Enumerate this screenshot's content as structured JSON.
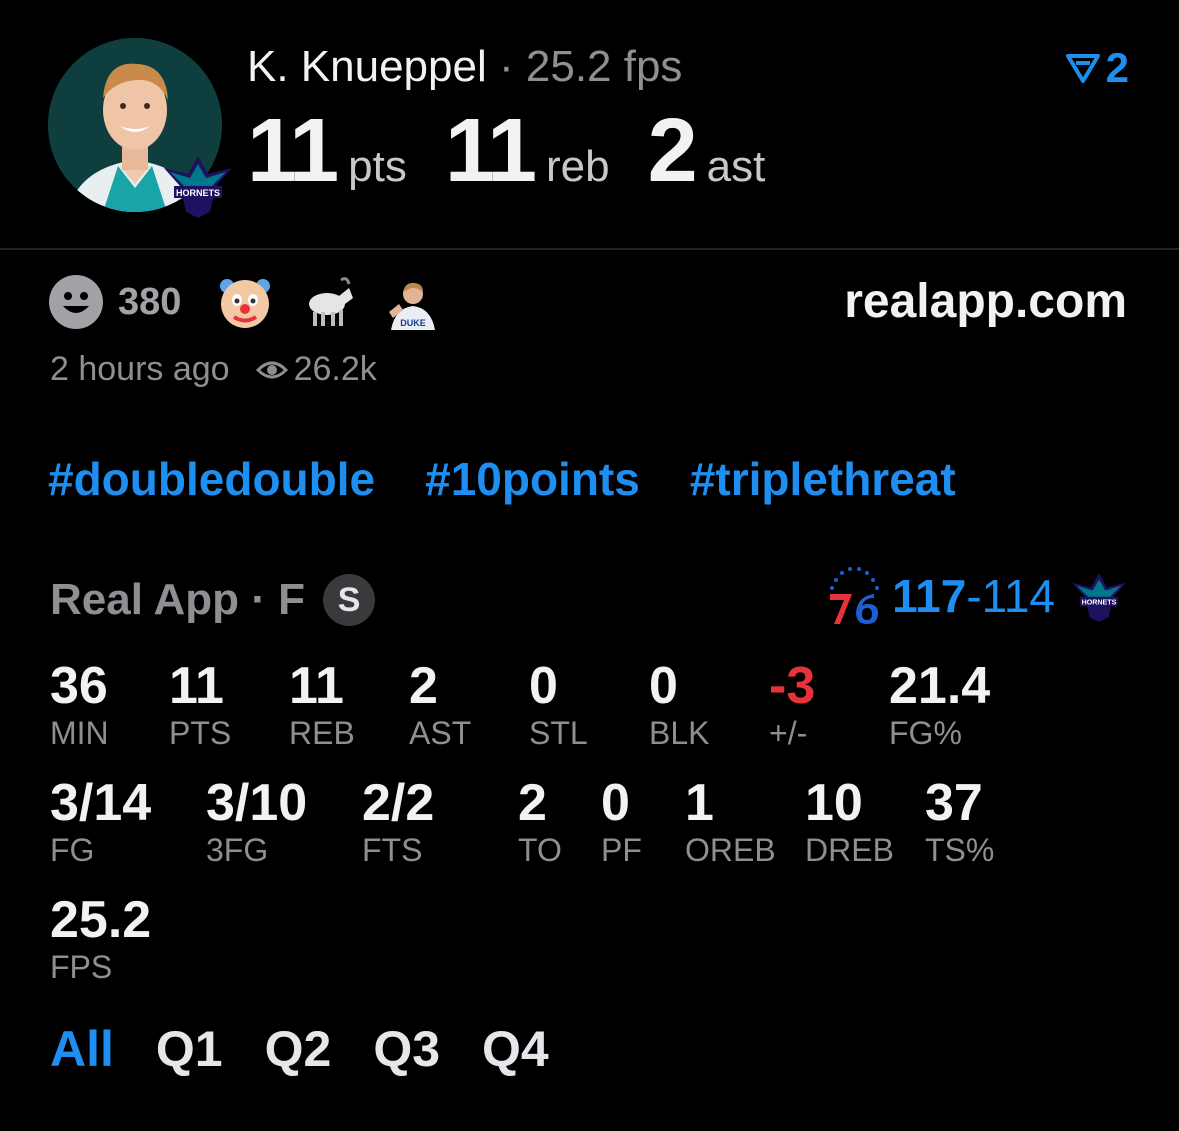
{
  "player": {
    "name": "K. Knueppel",
    "separator": "·",
    "fps_text": "25.2 fps",
    "headline": [
      {
        "value": "11",
        "unit": "pts"
      },
      {
        "value": "11",
        "unit": "reb"
      },
      {
        "value": "2",
        "unit": "ast"
      }
    ],
    "avatar_icon": "player-headshot",
    "team_logo_icon": "hornets-logo"
  },
  "rank": {
    "icon": "triangle-flag-icon",
    "value": "2"
  },
  "reactions": {
    "count": "380",
    "icons": [
      "smiley-face-icon",
      "clown-emoji",
      "goat-emoji",
      "player-sticker"
    ]
  },
  "site": "realapp.com",
  "meta": {
    "time_ago": "2 hours ago",
    "views": "26.2k"
  },
  "hashtags": [
    "#doubledouble",
    "#10points",
    "#triplethreat"
  ],
  "game": {
    "source": "Real App · F",
    "status_badge": "S",
    "home_score": "117",
    "dash": "-",
    "away_score": "114",
    "home_logo": "76ers-logo",
    "away_logo": "hornets-logo"
  },
  "stats_row1": [
    {
      "value": "36",
      "label": "MIN"
    },
    {
      "value": "11",
      "label": "PTS"
    },
    {
      "value": "11",
      "label": "REB"
    },
    {
      "value": "2",
      "label": "AST"
    },
    {
      "value": "0",
      "label": "STL"
    },
    {
      "value": "0",
      "label": "BLK"
    },
    {
      "value": "-3",
      "label": "+/-"
    },
    {
      "value": "21.4",
      "label": "FG%"
    }
  ],
  "stats_row2": [
    {
      "value": "3/14",
      "label": "FG"
    },
    {
      "value": "3/10",
      "label": "3FG"
    },
    {
      "value": "2/2",
      "label": "FTS"
    },
    {
      "value": "2",
      "label": "TO"
    },
    {
      "value": "0",
      "label": "PF"
    },
    {
      "value": "1",
      "label": "OREB"
    },
    {
      "value": "10",
      "label": "DREB"
    },
    {
      "value": "37",
      "label": "TS%"
    }
  ],
  "stats_row3": [
    {
      "value": "25.2",
      "label": "FPS"
    }
  ],
  "quarters": [
    "All",
    "Q1",
    "Q2",
    "Q3",
    "Q4"
  ],
  "colors": {
    "accent": "#1f8ef1",
    "negative": "#e8323a",
    "muted": "#8e8e93",
    "background": "#000000"
  }
}
